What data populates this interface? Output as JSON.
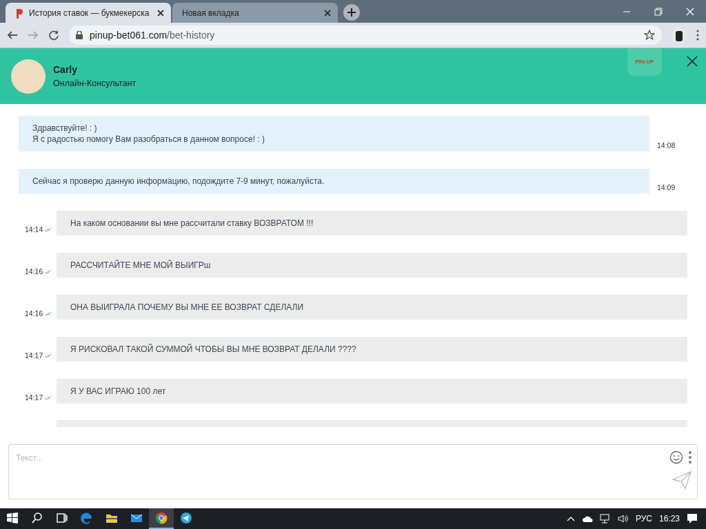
{
  "browser": {
    "tabs": [
      {
        "title": "История ставок — букмекерска",
        "selected": true
      },
      {
        "title": "Новая вкладка",
        "selected": false
      }
    ],
    "address": {
      "domain": "pinup-bet061.com",
      "path": "/bet-history"
    }
  },
  "chat_header": {
    "agent_name": "Carly",
    "agent_role": "Онлайн-Консультант",
    "logo_text": "PIN-UP"
  },
  "messages": [
    {
      "kind": "agent",
      "lines": [
        "Здравствуйте! : )",
        "Я с радостью помогу Вам разобраться в данном вопросе! : )"
      ],
      "time": "14:08"
    },
    {
      "kind": "agent",
      "lines": [
        "Сейчас я проверю данную информацию, подождите 7-9 минут, пожалуйста."
      ],
      "time": "14:09"
    },
    {
      "kind": "user",
      "lines": [
        "На каком основании вы мне рассчитали ставку ВОЗВРАТОМ !!!"
      ],
      "time": "14:14",
      "read": true
    },
    {
      "kind": "user",
      "lines": [
        "РАССЧИТАЙТЕ МНЕ МОЙ ВЫИГРш"
      ],
      "time": "14:16",
      "read": true
    },
    {
      "kind": "user",
      "lines": [
        "ОНА ВЫИГРАЛА ПОЧЕМУ ВЫ МНЕ ЕЕ ВОЗВРАТ СДЕЛАЛИ"
      ],
      "time": "14:16",
      "read": true
    },
    {
      "kind": "user",
      "lines": [
        "Я РИСКОВАЛ ТАКОЙ СУММОЙ ЧТОБЫ ВЫ МНЕ ВОЗВРАТ ДЕЛАЛИ ????"
      ],
      "time": "14:17",
      "read": true
    },
    {
      "kind": "user",
      "lines": [
        "Я У ВАС ИГРАЮ 100 лет"
      ],
      "time": "14:17",
      "read": true
    }
  ],
  "composer": {
    "placeholder": "Текст..."
  },
  "taskbar": {
    "apps": [
      {
        "kind": "edge",
        "selected": false
      },
      {
        "kind": "explorer",
        "selected": false
      },
      {
        "kind": "mail",
        "selected": false
      },
      {
        "kind": "chrome",
        "selected": true
      },
      {
        "kind": "telegram",
        "selected": false
      }
    ],
    "language": "РУС",
    "clock": "16:23"
  }
}
